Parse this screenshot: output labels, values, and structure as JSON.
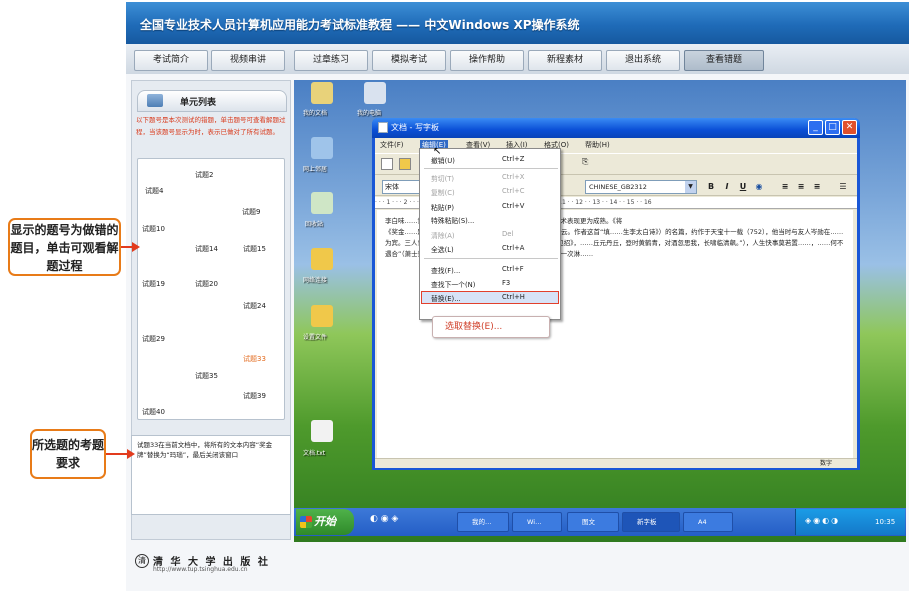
{
  "header": {
    "title": "全国专业技术人员计算机应用能力考试标准教程 —— 中文Windows XP操作系统"
  },
  "nav": {
    "tabs": [
      "考试简介",
      "视频串讲",
      "过章练习",
      "模拟考试",
      "操作帮助",
      "新程素材",
      "退出系统",
      "查看错题"
    ],
    "active": "查看错题"
  },
  "left": {
    "unit_title": "单元列表",
    "instructions": "以下题号是本次测试的错题，单击题号可查看解题过程，当该题号显示为时，表示已做对了所有试题。",
    "questions": [
      "试题2",
      "试题4",
      "试题9",
      "试题10",
      "试题14",
      "试题15",
      "试题19",
      "试题20",
      "试题24",
      "试题29",
      "试题33",
      "试题35",
      "试题39",
      "试题40"
    ],
    "selected": "试题33",
    "requirement": "试题33在当前文档中，将所有的文本内容“奖金牌”替换为“玛瑙”，最后关闭该窗口"
  },
  "callouts": {
    "error_items": "显示的题号为做错的题目，单击可观看解题过程",
    "requirement": "所选题的考题要求"
  },
  "footer": {
    "publisher": "清 华 大 学 出 版 社",
    "url": "http://www.tup.tsinghua.edu.cn"
  },
  "desktop": {
    "icons": [
      "我的文档",
      "我的电脑",
      "网上邻居",
      "回收站",
      "网络连接",
      "设置文件",
      "文档.txt"
    ]
  },
  "wordpad": {
    "title": "文档 - 写字板",
    "menus": [
      "文件(F)",
      "编辑(E)",
      "查看(V)",
      "插入(I)",
      "格式(O)",
      "帮助(H)"
    ],
    "open_menu": "编辑(E)",
    "font": "宋体",
    "charset": "CHINESE_GB2312",
    "ruler": "· · · 1 · · · 2 · · · 3 · · · 4 · · · 5 · · · 6 · · · 7 · · · 8 · · · 9 · · · 10 · · 11 · · 12 · · 13 · · 14 · · 15 · · 16",
    "doc_text": [
      "李白味……诗篇把数奖金放迁以后所作思想内容更为深沉，艺术表现更为成熟。《将",
      "《奖金……题目意译即“劝酒歌”，故古诗有“奖金牌，乘大白”云。作者这首“填……生李太白诗》）的名篇，约作于天宝十一载（752），他当时与友人岑勋在……为宾。三人曾登高饮宴（《酬岑勋见寻就元丹丘对酒相待以诗见招》，……丘元丹丘，登时黄鹤青，对酒忽思我，长啸临清飙。”），人生快事莫若置……，……何不遇合”（萧士赟）之际，于是满腔不合时宜借题抒泻诗情，来了一次淋……"
    ],
    "status": "数字",
    "edit_menu": {
      "items": [
        {
          "label": "撤销(U)",
          "shortcut": "Ctrl+Z",
          "enabled": true
        },
        {
          "label": "剪切(T)",
          "shortcut": "Ctrl+X",
          "enabled": false
        },
        {
          "label": "复制(C)",
          "shortcut": "Ctrl+C",
          "enabled": false
        },
        {
          "label": "粘贴(P)",
          "shortcut": "Ctrl+V",
          "enabled": true
        },
        {
          "label": "特殊粘贴(S)...",
          "shortcut": "",
          "enabled": true
        },
        {
          "label": "清除(A)",
          "shortcut": "Del",
          "enabled": false
        },
        {
          "label": "全选(L)",
          "shortcut": "Ctrl+A",
          "enabled": true
        },
        {
          "label": "查找(F)...",
          "shortcut": "Ctrl+F",
          "enabled": true
        },
        {
          "label": "查找下一个(N)",
          "shortcut": "F3",
          "enabled": true
        },
        {
          "label": "替换(E)...",
          "shortcut": "Ctrl+H",
          "enabled": true
        }
      ],
      "hint": "选取替换(E)..."
    }
  },
  "taskbar": {
    "start": "开始",
    "buttons": [
      "我的…",
      "Wi…",
      "图文",
      "新字板",
      "A4"
    ],
    "clock": "10:35"
  }
}
